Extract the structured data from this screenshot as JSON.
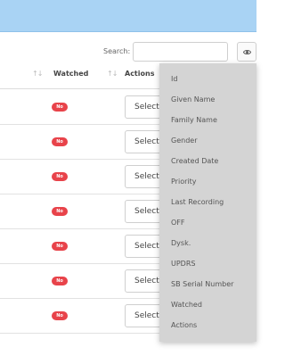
{
  "search": {
    "label": "Search:",
    "value": ""
  },
  "colvis": {
    "icon": "eye-icon"
  },
  "table": {
    "headers": {
      "watched": "Watched",
      "actions": "Actions"
    },
    "badge_color": "#e8434a",
    "rows": [
      {
        "watched": "No",
        "action": "Select"
      },
      {
        "watched": "No",
        "action": "Select"
      },
      {
        "watched": "No",
        "action": "Select"
      },
      {
        "watched": "No",
        "action": "Select"
      },
      {
        "watched": "No",
        "action": "Select"
      },
      {
        "watched": "No",
        "action": "Select"
      },
      {
        "watched": "No",
        "action": "Select An Action"
      }
    ]
  },
  "column_menu": {
    "items": [
      "Id",
      "Given Name",
      "Family Name",
      "Gender",
      "Created Date",
      "Priority",
      "Last Recording",
      "OFF",
      "Dysk.",
      "UPDRS",
      "SB Serial Number",
      "Watched",
      "Actions"
    ]
  }
}
